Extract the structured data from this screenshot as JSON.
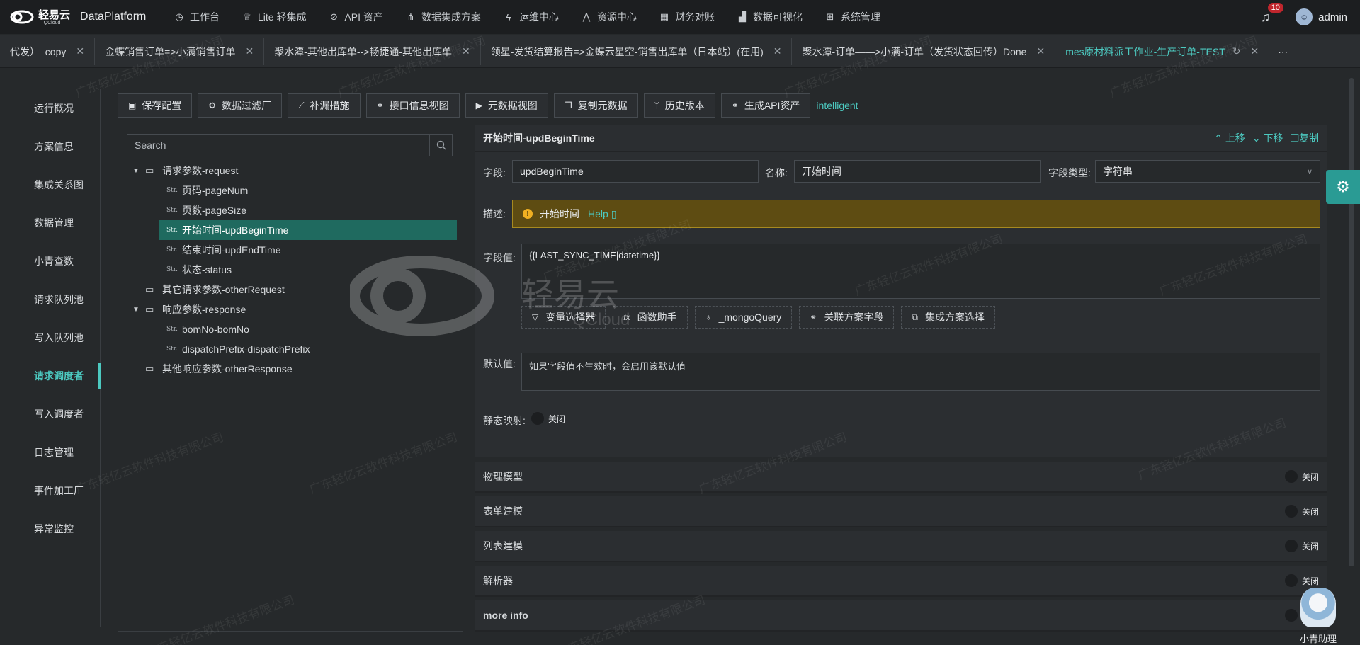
{
  "brand": {
    "logo_cn": "轻易云",
    "logo_en": "QCloud",
    "app_name": "DataPlatform"
  },
  "nav": [
    {
      "icon": "clock-icon",
      "label": "工作台"
    },
    {
      "icon": "badge-icon",
      "label": "Lite 轻集成"
    },
    {
      "icon": "compass-icon",
      "label": "API 资产"
    },
    {
      "icon": "network-icon",
      "label": "数据集成方案"
    },
    {
      "icon": "bolt-icon",
      "label": "运维中心"
    },
    {
      "icon": "hierarchy-icon",
      "label": "资源中心"
    },
    {
      "icon": "calculator-icon",
      "label": "财务对账"
    },
    {
      "icon": "chart-icon",
      "label": "数据可视化"
    },
    {
      "icon": "grid-icon",
      "label": "系统管理"
    }
  ],
  "user": {
    "name": "admin",
    "notifications": "10"
  },
  "tabs": [
    {
      "label": "代发）_copy"
    },
    {
      "label": "金蝶销售订单=>小满销售订单"
    },
    {
      "label": "聚水潭-其他出库单-->畅捷通-其他出库单"
    },
    {
      "label": "领星-发货结算报告=>金蝶云星空-销售出库单（日本站）(在用)"
    },
    {
      "label": "聚水潭-订单——>小满-订单（发货状态回传）Done"
    },
    {
      "label": "mes原材料派工作业-生产订单-TEST"
    }
  ],
  "tabs_more": "···",
  "sidebar": [
    {
      "label": "运行概况"
    },
    {
      "label": "方案信息"
    },
    {
      "label": "集成关系图"
    },
    {
      "label": "数据管理"
    },
    {
      "label": "小青查数"
    },
    {
      "label": "请求队列池"
    },
    {
      "label": "写入队列池"
    },
    {
      "label": "请求调度者"
    },
    {
      "label": "写入调度者"
    },
    {
      "label": "日志管理"
    },
    {
      "label": "事件加工厂"
    },
    {
      "label": "异常监控"
    }
  ],
  "toolbar": {
    "buttons": [
      {
        "icon": "save-icon",
        "label": "保存配置"
      },
      {
        "icon": "gear-icon",
        "label": "数据过滤厂"
      },
      {
        "icon": "trend-icon",
        "label": "补漏措施"
      },
      {
        "icon": "link-icon",
        "label": "接口信息视图"
      },
      {
        "icon": "terminal-icon",
        "label": "元数据视图"
      },
      {
        "icon": "copy-icon",
        "label": "复制元数据"
      },
      {
        "icon": "branch-icon",
        "label": "历史版本"
      },
      {
        "icon": "link-icon",
        "label": "生成API资产"
      }
    ],
    "mode_link": "intelligent"
  },
  "tree": {
    "search_placeholder": "Search",
    "nodes": [
      {
        "type": "folder",
        "expanded": true,
        "label": "请求参数-request"
      },
      {
        "type": "str",
        "label": "页码-pageNum"
      },
      {
        "type": "str",
        "label": "页数-pageSize"
      },
      {
        "type": "str",
        "label": "开始时间-updBeginTime",
        "selected": true
      },
      {
        "type": "str",
        "label": "结束时间-updEndTime"
      },
      {
        "type": "str",
        "label": "状态-status"
      },
      {
        "type": "folder",
        "label": "其它请求参数-otherRequest"
      },
      {
        "type": "folder",
        "expanded": true,
        "label": "响应参数-response"
      },
      {
        "type": "str",
        "label": "bomNo-bomNo"
      },
      {
        "type": "str",
        "label": "dispatchPrefix-dispatchPrefix"
      },
      {
        "type": "folder",
        "label": "其他响应参数-otherResponse"
      }
    ],
    "str_tag": "Str."
  },
  "form": {
    "title": "开始时间-updBeginTime",
    "actions": {
      "up": "上移",
      "down": "下移",
      "copy": "复制"
    },
    "field_label": "字段:",
    "field_value": "updBeginTime",
    "name_label": "名称:",
    "name_value": "开始时间",
    "type_label": "字段类型:",
    "type_value": "字符串",
    "desc_label": "描述:",
    "desc_text": "开始时间",
    "help_link": "Help",
    "value_label": "字段值:",
    "value_text": "{{LAST_SYNC_TIME|datetime}}",
    "tools": [
      {
        "icon": "filter-icon",
        "label": "变量选择器"
      },
      {
        "icon": "fx-icon",
        "label": "函数助手"
      },
      {
        "icon": "bulb-icon",
        "label": "_mongoQuery"
      },
      {
        "icon": "link-icon",
        "label": "关联方案字段"
      },
      {
        "icon": "layers-icon",
        "label": "集成方案选择"
      }
    ],
    "default_label": "默认值:",
    "default_placeholder": "如果字段值不生效时，会启用该默认值",
    "static_label": "静态映射:",
    "switch_off": "关闭"
  },
  "sections": [
    {
      "title": "物理模型",
      "state": "关闭"
    },
    {
      "title": "表单建模",
      "state": "关闭"
    },
    {
      "title": "列表建模",
      "state": "关闭"
    },
    {
      "title": "解析器",
      "state": "关闭"
    },
    {
      "title": "more info",
      "state": "关闭"
    }
  ],
  "assistant_label": "小青助理",
  "watermark": {
    "text": "广东轻亿云软件科技有限公司",
    "logo_cn": "轻易云",
    "logo_en": "QCloud"
  },
  "colors": {
    "accent": "#4cc9c0",
    "selected_row": "#1f6a5f",
    "warning_bg": "#5e4c12",
    "badge": "#c0262d"
  }
}
